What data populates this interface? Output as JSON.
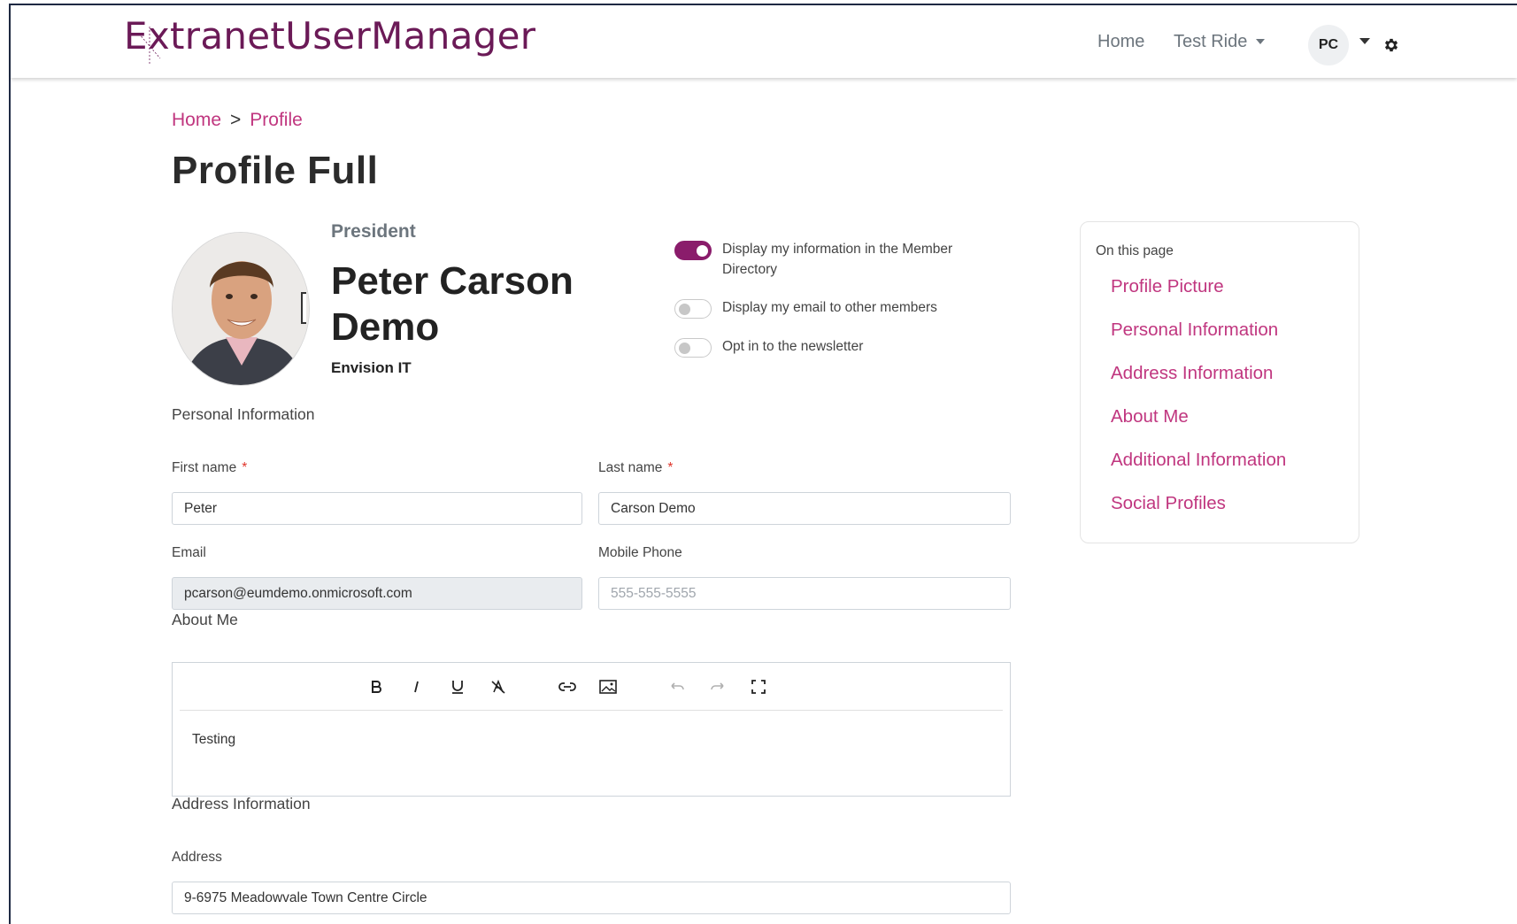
{
  "app": {
    "brand": "ExtranetUserManager"
  },
  "nav": {
    "home": "Home",
    "test_ride": "Test Ride",
    "user_initials": "PC"
  },
  "breadcrumb": {
    "home": "Home",
    "separator": ">",
    "current": "Profile"
  },
  "page_title": "Profile Full",
  "profile": {
    "position": "President",
    "name": "Peter Carson Demo",
    "company": "Envision IT"
  },
  "toggles": [
    {
      "label": "Display my information in the Member Directory",
      "on": true
    },
    {
      "label": "Display my email to other members",
      "on": false
    },
    {
      "label": "Opt in to the newsletter",
      "on": false
    }
  ],
  "sidebar": {
    "heading": "On this page",
    "items": [
      "Profile Picture",
      "Personal Information",
      "Address Information",
      "About Me",
      "Additional Information",
      "Social Profiles"
    ]
  },
  "sections": {
    "personal": "Personal Information",
    "about": "About Me",
    "address": "Address Information"
  },
  "form": {
    "first_name_label": "First name",
    "first_name_value": "Peter",
    "last_name_label": "Last name",
    "last_name_value": "Carson Demo",
    "required_mark": "*",
    "email_label": "Email",
    "email_value": "pcarson@eumdemo.onmicrosoft.com",
    "mobile_label": "Mobile Phone",
    "mobile_placeholder": "555-555-5555",
    "address_label": "Address",
    "address_value": "9-6975 Meadowvale Town Centre Circle"
  },
  "editor": {
    "content": "Testing",
    "toolbar": [
      "bold-icon",
      "italic-icon",
      "underline-icon",
      "clear-format-icon",
      "link-icon",
      "image-icon",
      "undo-icon",
      "redo-icon",
      "fullscreen-icon"
    ]
  },
  "colors": {
    "brand": "#6b1a57",
    "accent": "#c0367f",
    "toggle_on": "#8a1c6b"
  }
}
